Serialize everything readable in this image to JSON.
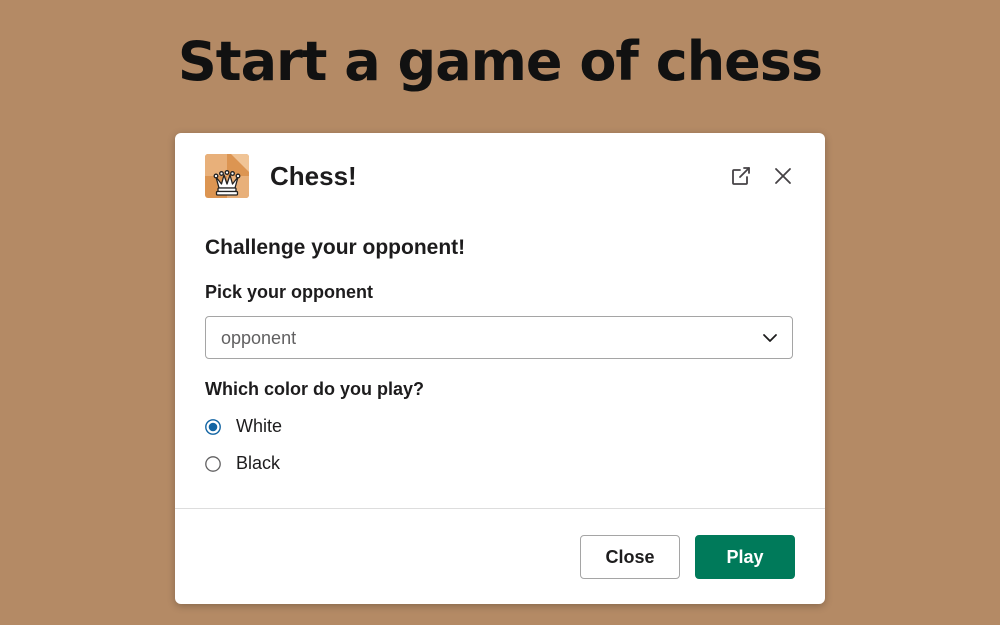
{
  "page": {
    "headline": "Start a game of chess"
  },
  "modal": {
    "app_icon": "chess-queen-icon",
    "title": "Chess!",
    "header_icons": [
      "external-link-icon",
      "close-icon"
    ],
    "section_title": "Challenge your opponent!",
    "opponent": {
      "label": "Pick your opponent",
      "value": "opponent",
      "icon": "chevron-down-icon"
    },
    "color": {
      "label": "Which color do you play?",
      "options": [
        {
          "label": "White",
          "selected": true
        },
        {
          "label": "Black",
          "selected": false
        }
      ]
    },
    "footer": {
      "close_label": "Close",
      "play_label": "Play"
    }
  },
  "colors": {
    "background": "#b48a65",
    "primary_button": "#007a5a",
    "radio_selected": "#1264a3"
  }
}
